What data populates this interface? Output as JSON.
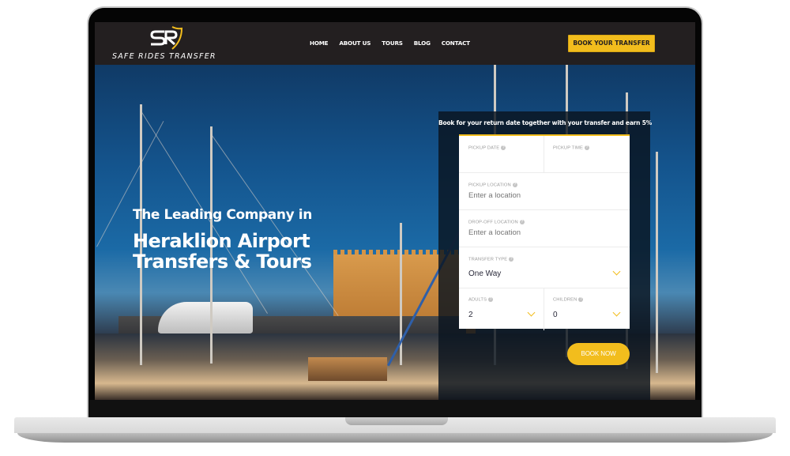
{
  "brand": {
    "logo_initials": "SR",
    "name": "Safe Rides Transfer"
  },
  "colors": {
    "accent": "#f2bd1d",
    "header_bg": "#231f20",
    "panel_bg": "#0a141e"
  },
  "nav": {
    "items": [
      {
        "label": "HOME"
      },
      {
        "label": "ABOUT US"
      },
      {
        "label": "TOURS"
      },
      {
        "label": "BLOG"
      },
      {
        "label": "CONTACT"
      }
    ],
    "cta_label": "BOOK YOUR TRANSFER"
  },
  "hero": {
    "subtitle": "The Leading Company in",
    "title_line1": "Heraklion Airport",
    "title_line2": "Transfers & Tours"
  },
  "booking": {
    "promo": "Book for your return date together with your transfer and earn 5%",
    "pickup_date": {
      "label": "PICKUP DATE",
      "value": ""
    },
    "pickup_time": {
      "label": "PICKUP TIME",
      "value": ""
    },
    "pickup_location": {
      "label": "PICKUP LOCATION",
      "placeholder": "Enter a location"
    },
    "dropoff_location": {
      "label": "DROP-OFF LOCATION",
      "placeholder": "Enter a location"
    },
    "transfer_type": {
      "label": "TRANSFER TYPE",
      "value": "One Way"
    },
    "adults": {
      "label": "ADULTS",
      "value": "2"
    },
    "children": {
      "label": "CHILDREN",
      "value": "0"
    },
    "help_glyph": "?",
    "submit_label": "BOOK NOW"
  }
}
